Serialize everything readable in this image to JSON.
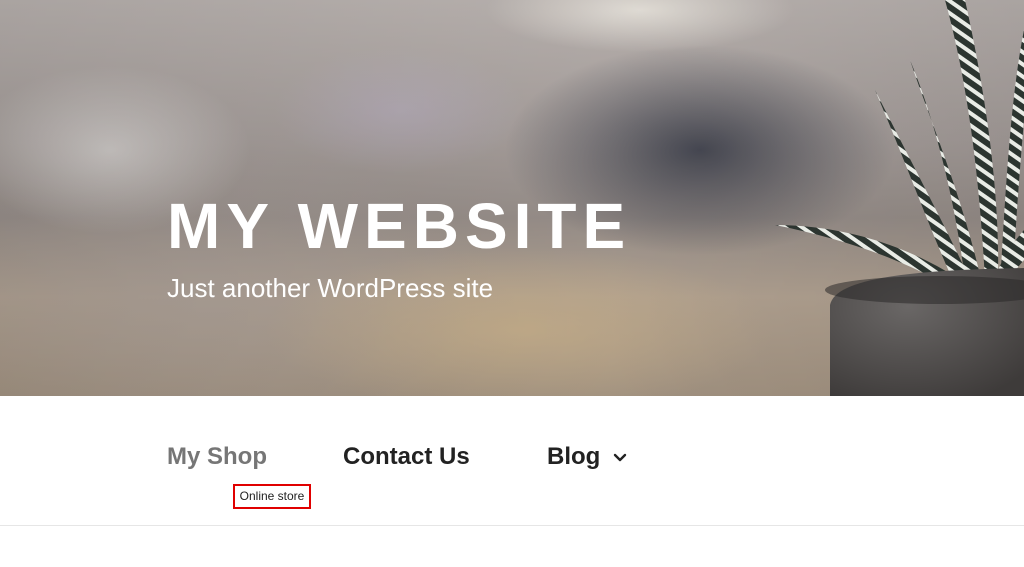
{
  "header": {
    "site_title": "MY WEBSITE",
    "tagline": "Just another WordPress site"
  },
  "nav": {
    "items": [
      {
        "label": "My Shop",
        "description": "Online store",
        "current": true
      },
      {
        "label": "Contact Us"
      },
      {
        "label": "Blog",
        "has_submenu": true,
        "icon": "chevron-down-icon"
      }
    ]
  },
  "colors": {
    "title_text": "#ffffff",
    "nav_text": "#222222",
    "nav_current": "#767676",
    "highlight_border": "#e00000"
  }
}
